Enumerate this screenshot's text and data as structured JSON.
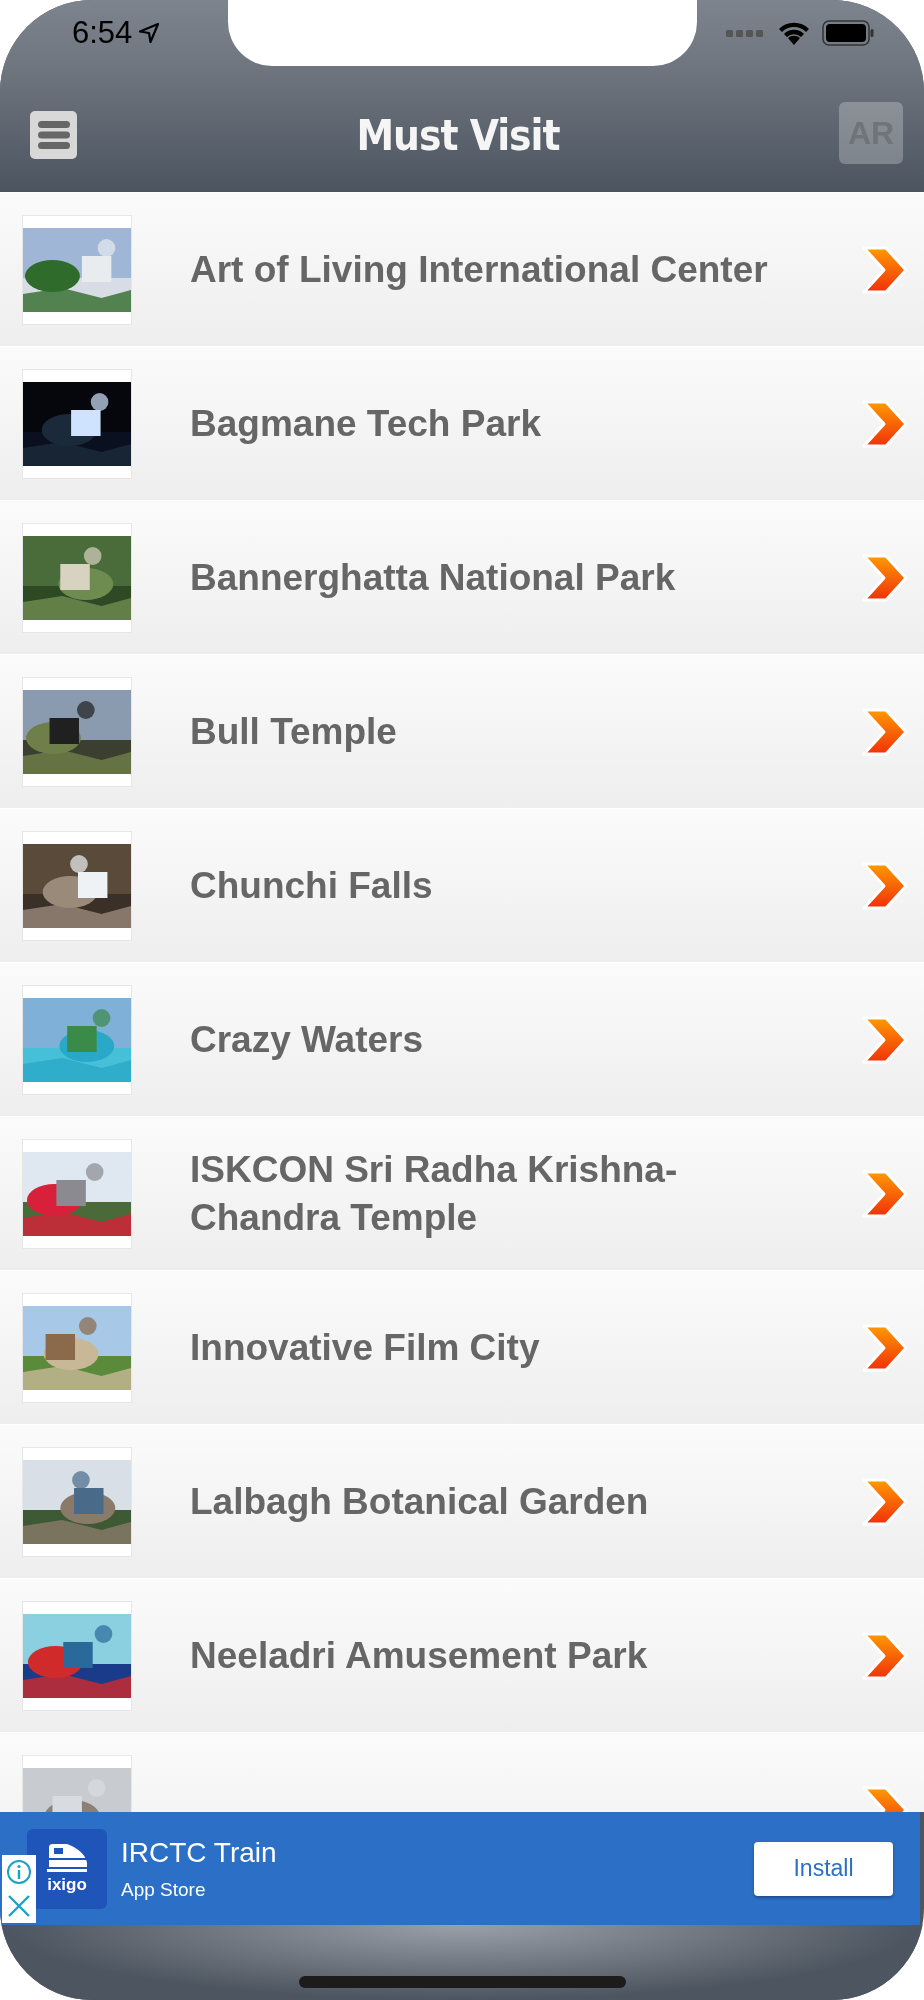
{
  "status_bar": {
    "time": "6:54"
  },
  "nav_bar": {
    "title": "Must Visit",
    "ar_button": "AR"
  },
  "places": [
    {
      "name": "Art of Living International Center",
      "thumbnail": {
        "kind": "picture"
      }
    },
    {
      "name": "Bagmane Tech Park",
      "thumbnail": {
        "kind": "picture"
      }
    },
    {
      "name": "Bannerghatta National Park",
      "thumbnail": {
        "kind": "picture"
      }
    },
    {
      "name": "Bull Temple",
      "thumbnail": {
        "kind": "picture"
      }
    },
    {
      "name": "Chunchi Falls",
      "thumbnail": {
        "kind": "picture"
      }
    },
    {
      "name": "Crazy Waters",
      "thumbnail": {
        "kind": "picture"
      }
    },
    {
      "name": "ISKCON Sri Radha Krishna-Chandra Temple",
      "thumbnail": {
        "kind": "picture"
      }
    },
    {
      "name": "Innovative Film City",
      "thumbnail": {
        "kind": "picture"
      }
    },
    {
      "name": "Lalbagh Botanical Garden",
      "thumbnail": {
        "kind": "picture"
      }
    },
    {
      "name": "Neeladri Amusement Park",
      "thumbnail": {
        "kind": "picture"
      }
    },
    {
      "thumbnail": {
        "kind": "picture"
      }
    }
  ],
  "ad_banner": {
    "app_logo_text": "ixigo",
    "title": "IRCTC Train",
    "subtitle": "App Store",
    "button": "Install"
  }
}
